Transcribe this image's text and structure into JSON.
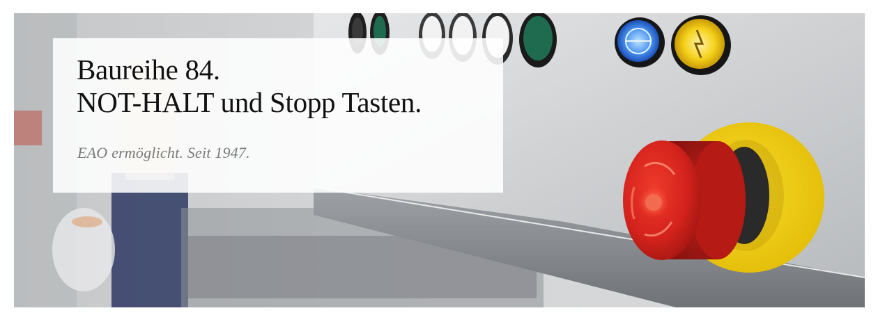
{
  "banner": {
    "headline_line1": "Baureihe 84.",
    "headline_line2": "NOT-HALT und Stopp Tasten.",
    "tagline": "EAO ermöglicht. Seit 1947."
  },
  "colors": {
    "emergency_stop_red": "#d4231c",
    "emergency_stop_ring_yellow": "#f2cf13",
    "indicator_blue": "#2a6fd9",
    "indicator_yellow": "#f5d21c",
    "button_green": "#1f6b4f",
    "panel_steel": "#c8cbce"
  },
  "icons": [
    "emergency-stop-button",
    "illuminated-pushbutton-blue",
    "illuminated-pushbutton-yellow",
    "pushbutton-green",
    "pushbutton-white"
  ]
}
